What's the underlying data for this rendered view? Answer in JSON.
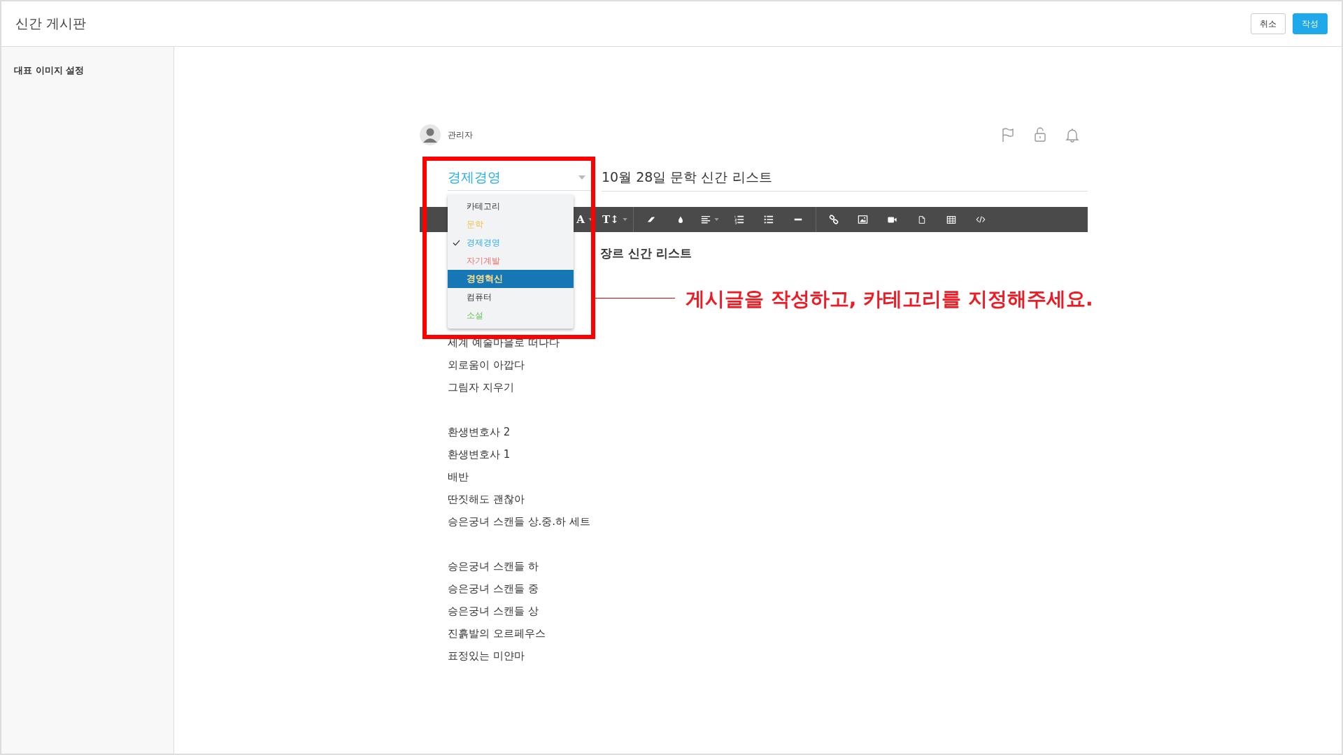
{
  "header": {
    "title": "신간 게시판",
    "buttons": [
      {
        "label": "취소",
        "kind": "secondary"
      },
      {
        "label": "작성",
        "kind": "primary"
      }
    ]
  },
  "sidebar": {
    "items": [
      "대표 이미지 설정"
    ]
  },
  "post": {
    "author": "관리자",
    "category": {
      "value": "경제경영",
      "options": [
        {
          "label": "카테고리",
          "color": "#333333",
          "checked": false,
          "highlighted": false
        },
        {
          "label": "문학",
          "color": "#f0c24b",
          "checked": false,
          "highlighted": false
        },
        {
          "label": "경제경영",
          "color": "#29aee8",
          "checked": true,
          "highlighted": false
        },
        {
          "label": "자기계발",
          "color": "#f07070",
          "checked": false,
          "highlighted": false
        },
        {
          "label": "경영혁신",
          "color": "#ffe08a",
          "checked": false,
          "highlighted": true
        },
        {
          "label": "컴퓨터",
          "color": "#333333",
          "checked": false,
          "highlighted": false
        },
        {
          "label": "소설",
          "color": "#6cc65a",
          "checked": false,
          "highlighted": false
        }
      ]
    },
    "title": "10월 28일 문학 신간 리스트",
    "toolbar": [
      {
        "kind": "text",
        "label": "A",
        "caret": true
      },
      {
        "kind": "text",
        "label": "T↕",
        "caret": true
      },
      {
        "kind": "separator"
      },
      {
        "kind": "eraser"
      },
      {
        "kind": "drop"
      },
      {
        "kind": "align",
        "caret": true
      },
      {
        "kind": "ordered-list"
      },
      {
        "kind": "bullet-list"
      },
      {
        "kind": "rule"
      },
      {
        "kind": "separator"
      },
      {
        "kind": "link"
      },
      {
        "kind": "image"
      },
      {
        "kind": "video"
      },
      {
        "kind": "file"
      },
      {
        "kind": "table"
      },
      {
        "kind": "code"
      }
    ],
    "lines": [
      {
        "kind": "heading",
        "text": "장르 신간 리스트"
      },
      {
        "kind": "hidden"
      },
      {
        "kind": "hidden"
      },
      {
        "kind": "hidden"
      },
      {
        "kind": "text",
        "text": "세계 예술마을로 떠나다"
      },
      {
        "kind": "text",
        "text": "외로움이 아깝다"
      },
      {
        "kind": "text",
        "text": "그림자 지우기"
      },
      {
        "kind": "blank"
      },
      {
        "kind": "text",
        "text": "환생변호사 2"
      },
      {
        "kind": "text",
        "text": "환생변호사 1"
      },
      {
        "kind": "text",
        "text": "배반"
      },
      {
        "kind": "text",
        "text": "딴짓해도 괜찮아"
      },
      {
        "kind": "text",
        "text": "승은궁녀 스캔들 상.중.하 세트"
      },
      {
        "kind": "blank"
      },
      {
        "kind": "text",
        "text": "승은궁녀 스캔들 하"
      },
      {
        "kind": "text",
        "text": "승은궁녀 스캔들 중"
      },
      {
        "kind": "text",
        "text": "승은궁녀 스캔들 상"
      },
      {
        "kind": "text",
        "text": "진흙발의 오르페우스"
      },
      {
        "kind": "text",
        "text": "표정있는 미얀마"
      }
    ]
  },
  "annotation": {
    "text": "게시글을 작성하고, 카테고리를 지정해주세요."
  }
}
